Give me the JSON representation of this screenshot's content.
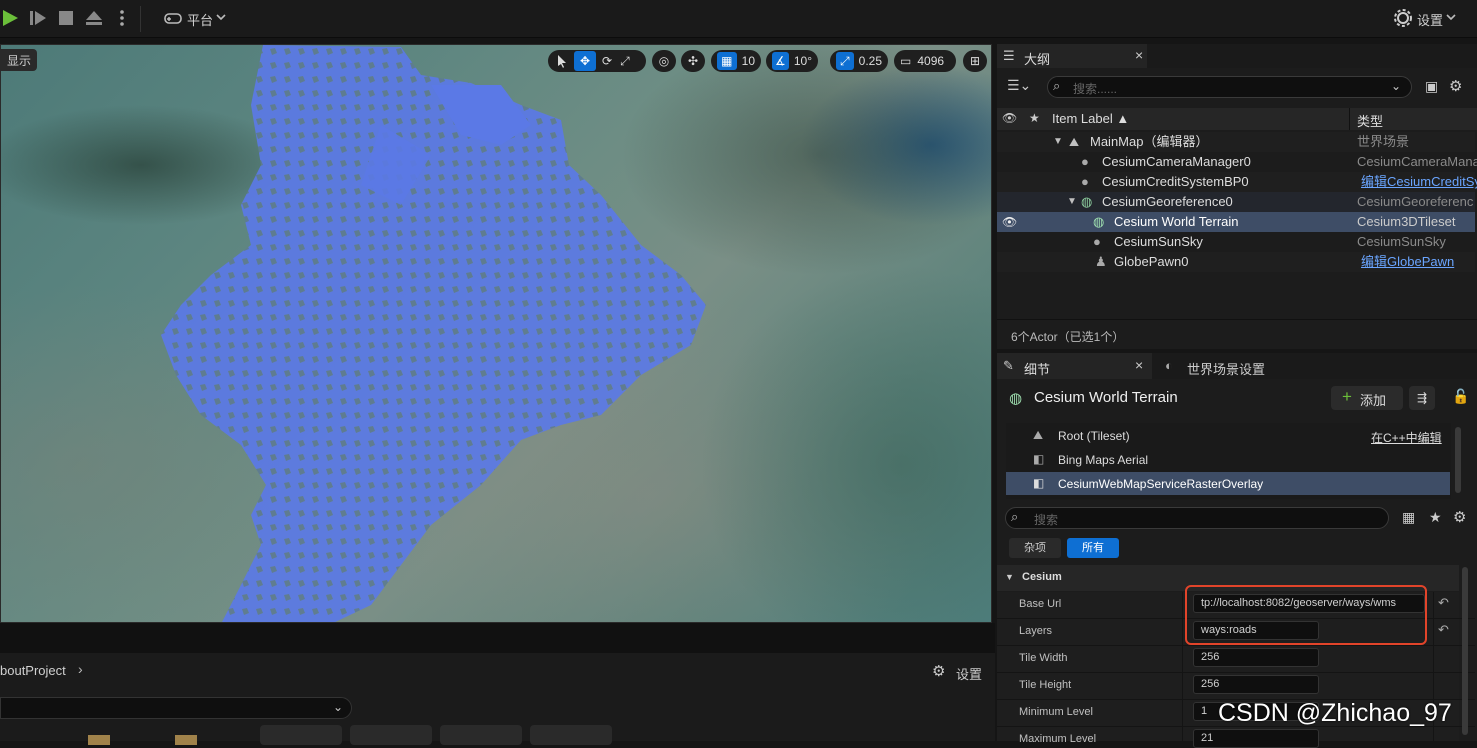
{
  "toolbar": {
    "platform_label": "平台",
    "settings_label": "设置"
  },
  "viewport": {
    "show_label": "显示",
    "grid_value": "10",
    "angle_value": "10°",
    "scale_value": "0.25",
    "camera_value": "4096"
  },
  "outliner": {
    "tab_title": "大纲",
    "search_placeholder": "搜索......",
    "col_label": "Item Label ▲",
    "col_type": "类型",
    "rows": [
      {
        "label": "MainMap（编辑器）",
        "type": "世界场景"
      },
      {
        "label": "CesiumCameraManager0",
        "type": "CesiumCameraMana"
      },
      {
        "label": "CesiumCreditSystemBP0",
        "type": "编辑CesiumCreditSy"
      },
      {
        "label": "CesiumGeoreference0",
        "type": "CesiumGeoreferenc"
      },
      {
        "label": "Cesium World Terrain",
        "type": "Cesium3DTileset"
      },
      {
        "label": "CesiumSunSky",
        "type": "CesiumSunSky"
      },
      {
        "label": "GlobePawn0",
        "type": "编辑GlobePawn"
      }
    ],
    "footer": "6个Actor（已选1个）"
  },
  "details": {
    "tab_title": "细节",
    "tab_world": "世界场景设置",
    "object_name": "Cesium World Terrain",
    "add_label": "添加",
    "components": [
      {
        "label": "Root (Tileset)",
        "extra": "在C++中编辑"
      },
      {
        "label": "Bing Maps Aerial"
      },
      {
        "label": "CesiumWebMapServiceRasterOverlay"
      }
    ],
    "search_placeholder": "搜索",
    "filter_misc": "杂项",
    "filter_all": "所有",
    "category": "Cesium",
    "props": [
      {
        "label": "Base Url",
        "value": "tp://localhost:8082/geoserver/ways/wms"
      },
      {
        "label": "Layers",
        "value": "ways:roads"
      },
      {
        "label": "Tile Width",
        "value": "256"
      },
      {
        "label": "Tile Height",
        "value": "256"
      },
      {
        "label": "Minimum Level",
        "value": "1"
      },
      {
        "label": "Maximum Level",
        "value": "21"
      }
    ]
  },
  "content": {
    "breadcrumb": "boutProject",
    "settings_label": "设置"
  },
  "watermark": "CSDN @Zhichao_97"
}
